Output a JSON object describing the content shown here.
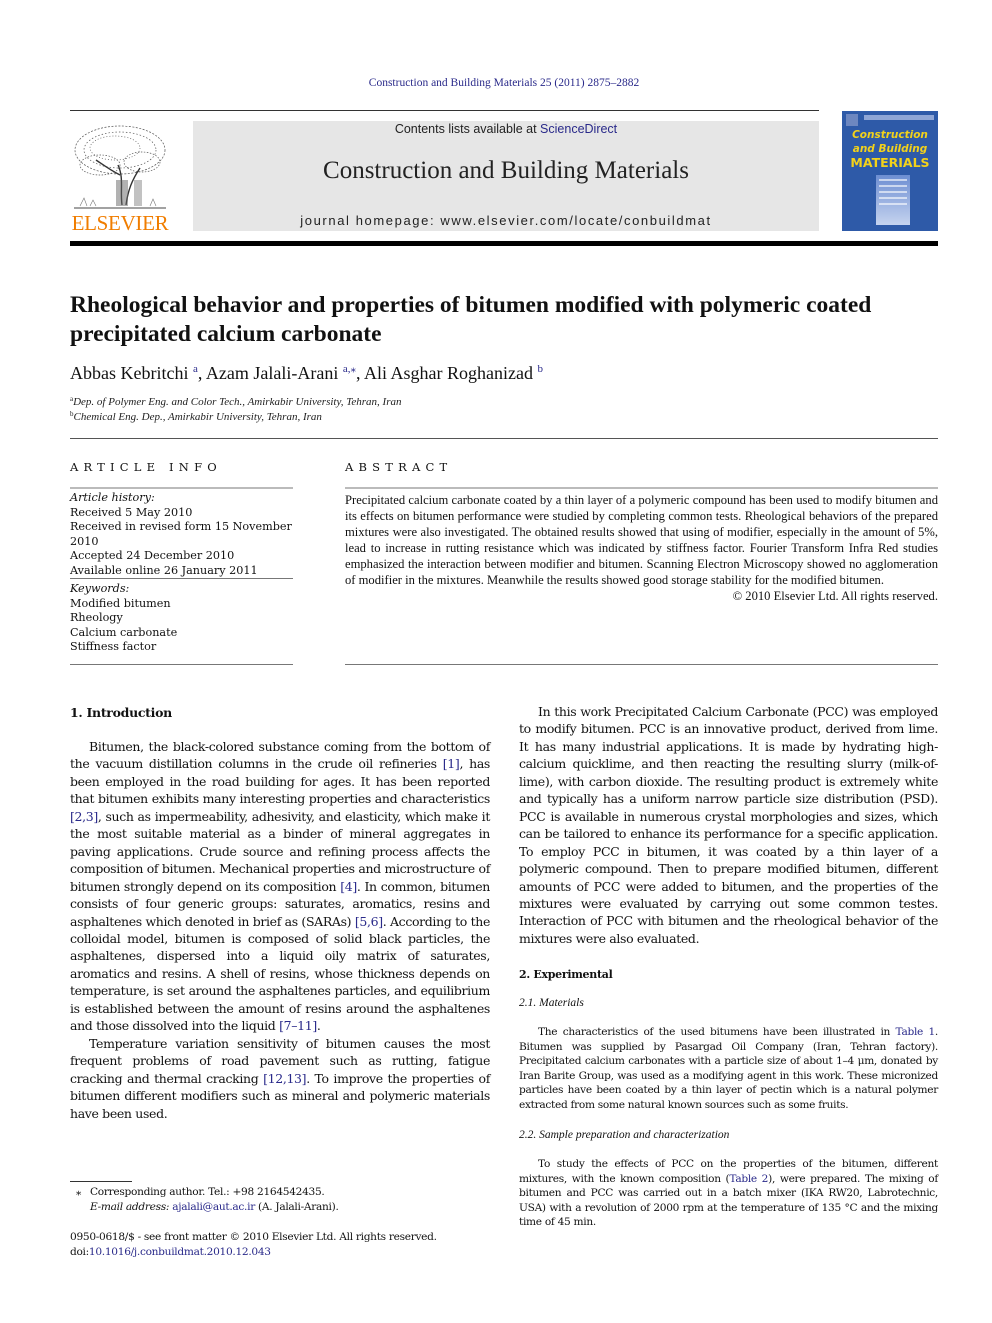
{
  "running_head": "Construction and Building Materials 25 (2011) 2875–2882",
  "masthead": {
    "publisher": "ELSEVIER",
    "contents_prefix": "Contents lists available at ",
    "contents_link": "ScienceDirect",
    "journal_name": "Construction and Building Materials",
    "homepage": "journal homepage: www.elsevier.com/locate/conbuildmat",
    "cover": {
      "line1": "Construction",
      "line2": "and Building",
      "line3": "MATERIALS",
      "bg_color": "#2e5aa8",
      "text_color": "#f3d21a"
    },
    "publisher_color": "#f07d00"
  },
  "article": {
    "title": "Rheological behavior and properties of bitumen modified with polymeric coated precipitated calcium carbonate",
    "authors": [
      {
        "name": "Abbas Kebritchi",
        "sup": "a",
        "sep": ", "
      },
      {
        "name": "Azam Jalali-Arani",
        "sup": "a,⁎",
        "sep": ", "
      },
      {
        "name": "Ali Asghar Roghanizad",
        "sup": "b",
        "sep": ""
      }
    ],
    "affiliations": [
      {
        "mark": "a",
        "text": "Dep. of Polymer Eng. and Color Tech., Amirkabir University, Tehran, Iran"
      },
      {
        "mark": "b",
        "text": "Chemical Eng. Dep., Amirkabir University, Tehran, Iran"
      }
    ]
  },
  "article_info": {
    "label": "ARTICLE INFO",
    "history_heading": "Article history:",
    "history": [
      "Received 5 May 2010",
      "Received in revised form 15 November 2010",
      "Accepted 24 December 2010",
      "Available online 26 January 2011"
    ],
    "keywords_heading": "Keywords:",
    "keywords": [
      "Modified bitumen",
      "Rheology",
      "Calcium carbonate",
      "Stiffness factor"
    ]
  },
  "abstract": {
    "label": "ABSTRACT",
    "text": "Precipitated calcium carbonate coated by a thin layer of a polymeric compound has been used to modify bitumen and its effects on bitumen performance were studied by completing common tests. Rheological behaviors of the prepared mixtures were also investigated. The obtained results showed that using of modifier, especially in the amount of 5%, lead to increase in rutting resistance which was indicated by stiffness factor. Fourier Transform Infra Red studies emphasized the interaction between modifier and bitumen. Scanning Electron Microscopy showed no agglomeration of modifier in the mixtures. Meanwhile the results showed good storage stability for the modified bitumen.",
    "copyright": "© 2010 Elsevier Ltd. All rights reserved."
  },
  "introduction": {
    "heading": "1. Introduction",
    "p1": [
      {
        "t": "Bitumen, the black-colored substance coming from the bottom of the vacuum distillation columns in the crude oil refineries "
      },
      {
        "ref": "[1]"
      },
      {
        "t": ", has been employed in the road building for ages. It has been reported that bitumen exhibits many interesting properties and characteristics "
      },
      {
        "ref": "[2,3]"
      },
      {
        "t": ", such as impermeability, adhesivity, and elasticity, which make it the most suitable material as a binder of mineral aggregates in paving applications. Crude source and refining process affects the composition of bitumen. Mechanical properties and microstructure of bitumen strongly depend on its composition "
      },
      {
        "ref": "[4]"
      },
      {
        "t": ". In common, bitumen consists of four generic groups: saturates, aromatics, resins and asphaltenes which denoted in brief as (SARAs) "
      },
      {
        "ref": "[5,6]"
      },
      {
        "t": ". According to the colloidal model, bitumen is composed of solid black particles, the asphaltenes, dispersed into a liquid oily matrix of saturates, aromatics and resins. A shell of resins, whose thickness depends on temperature, is set around the asphaltenes particles, and equilibrium is established between the amount of resins around the asphaltenes and those dissolved into the liquid "
      },
      {
        "ref": "[7–11]"
      },
      {
        "t": "."
      }
    ],
    "p2": [
      {
        "t": "Temperature variation sensitivity of bitumen causes the most frequent problems of road pavement such as rutting, fatigue cracking and thermal cracking "
      },
      {
        "ref": "[12,13]"
      },
      {
        "t": ". To improve the properties of bitumen different modifiers such as mineral and polymeric materials have been used."
      }
    ],
    "p3": "In this work Precipitated Calcium Carbonate (PCC) was employed to modify bitumen. PCC is an innovative product, derived from lime. It has many industrial applications. It is made by hydrating high-calcium quicklime, and then reacting the resulting slurry (milk-of-lime), with carbon dioxide. The resulting product is extremely white and typically has a uniform narrow particle size distribution (PSD). PCC is available in numerous crystal morphologies and sizes, which can be tailored to enhance its performance for a specific application. To employ PCC in bitumen, it was coated by a thin layer of a polymeric compound. Then to prepare modified bitumen, different amounts of PCC were added to bitumen, and the properties of the mixtures were evaluated by carrying out some common testes. Interaction of PCC with bitumen and the rheological behavior of the mixtures were also evaluated."
  },
  "experimental": {
    "heading": "2. Experimental",
    "materials_heading": "2.1. Materials",
    "materials_text": [
      {
        "t": "The characteristics of the used bitumens have been illustrated in "
      },
      {
        "ref": "Table 1"
      },
      {
        "t": ". Bitumen was supplied by Pasargad Oil Company (Iran, Tehran factory). Precipitated calcium carbonates with a particle size of about 1–4 μm, donated by Iran Barite Group, was used as a modifying agent in this work. These micronized particles have been coated by a thin layer of pectin which is a natural polymer extracted from some natural known sources such as some fruits."
      }
    ],
    "prep_heading": "2.2. Sample preparation and characterization",
    "prep_text": [
      {
        "t": "To study the effects of PCC on the properties of the bitumen, different mixtures, with the known composition ("
      },
      {
        "ref": "Table 2"
      },
      {
        "t": "), were prepared. The mixing of bitumen and PCC was carried out in a batch mixer (IKA RW20, Labrotechnic, USA) with a revolution of 2000 rpm at the temperature of 135 °C and the mixing time of 45 min."
      }
    ]
  },
  "footnote": {
    "star": "⁎",
    "corresponding": "Corresponding author. Tel.: +98 2164542435.",
    "email_label": "E-mail address: ",
    "email": "ajalali@aut.ac.ir",
    "email_suffix": " (A. Jalali-Arani)."
  },
  "front_matter": {
    "issn_line": "0950-0618/$ - see front matter © 2010 Elsevier Ltd. All rights reserved.",
    "doi_prefix": "doi:",
    "doi": "10.1016/j.conbuildmat.2010.12.043"
  },
  "link_color": "#2a2a8a"
}
